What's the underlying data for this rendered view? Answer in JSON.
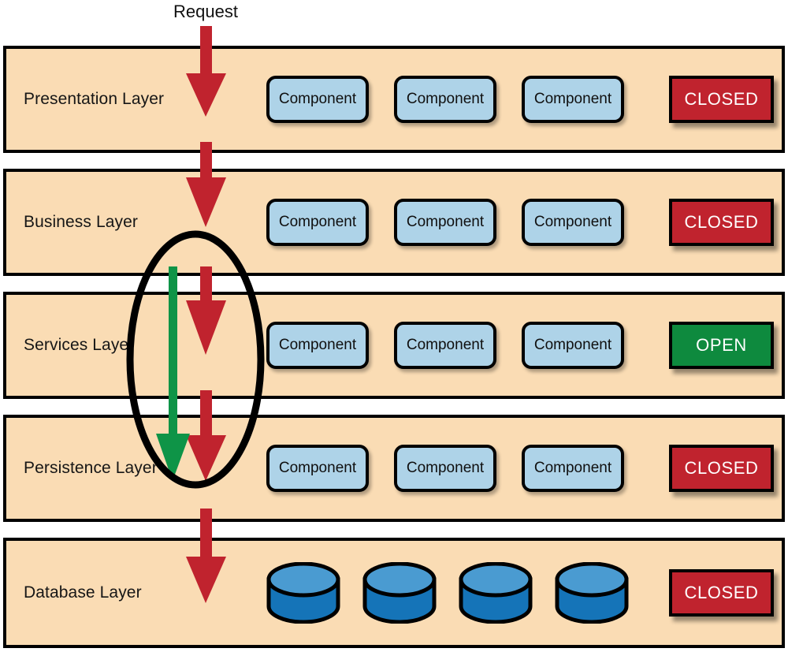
{
  "diagram": {
    "title_label": "Request",
    "colors": {
      "band_fill": "#FADCB4",
      "band_stroke": "#000000",
      "component_fill": "#AED3E8",
      "closed_badge": "#C0232E",
      "open_badge": "#0E8A3E",
      "request_arrow": "#C0232E",
      "bypass_arrow": "#0E9447",
      "db_top": "#4A9BD1",
      "db_body": "#1574B8",
      "highlight_ellipse": "#000000"
    },
    "layers": [
      {
        "name": "Presentation Layer",
        "components": [
          "Component",
          "Component",
          "Component"
        ],
        "status": "CLOSED",
        "status_state": "closed"
      },
      {
        "name": "Business Layer",
        "components": [
          "Component",
          "Component",
          "Component"
        ],
        "status": "CLOSED",
        "status_state": "closed"
      },
      {
        "name": "Services Layer",
        "components": [
          "Component",
          "Component",
          "Component"
        ],
        "status": "OPEN",
        "status_state": "open"
      },
      {
        "name": "Persistence Layer",
        "components": [
          "Component",
          "Component",
          "Component"
        ],
        "status": "CLOSED",
        "status_state": "closed"
      },
      {
        "name": "Database Layer",
        "components": [],
        "databases": [
          "database",
          "database",
          "database",
          "database"
        ],
        "status": "CLOSED",
        "status_state": "closed"
      }
    ],
    "annotations": {
      "request_flow": "Request",
      "bypass_note": "green arrow bypasses the open Services Layer",
      "highlight_note": "ellipse highlights layer-skipping flow"
    }
  }
}
